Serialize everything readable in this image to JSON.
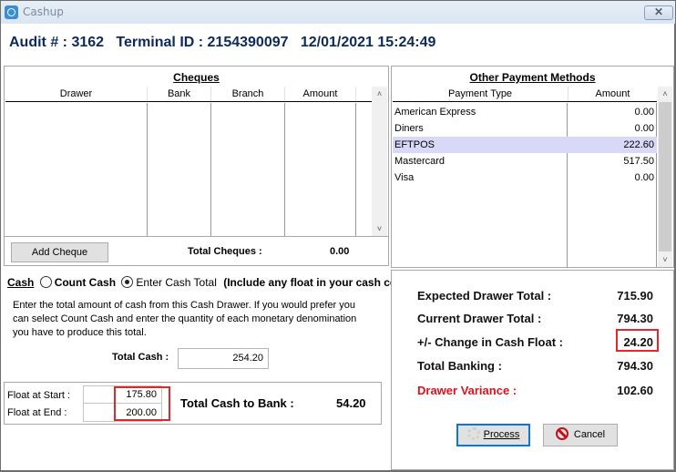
{
  "window": {
    "title": "Cashup",
    "close_label": "✕"
  },
  "header": {
    "text": "Audit # : 3162   Terminal ID : 2154390097   12/01/2021 15:24:49"
  },
  "cheques": {
    "title": "Cheques",
    "columns": [
      "Drawer",
      "Bank",
      "Branch",
      "Amount"
    ],
    "rows": [],
    "add_button": "Add Cheque",
    "total_label": "Total Cheques :",
    "total_value": "0.00"
  },
  "payments": {
    "title": "Other Payment Methods",
    "columns": [
      "Payment Type",
      "Amount"
    ],
    "rows": [
      {
        "type": "American Express",
        "amount": "0.00"
      },
      {
        "type": "Diners",
        "amount": "0.00"
      },
      {
        "type": "EFTPOS",
        "amount": "222.60"
      },
      {
        "type": "Mastercard",
        "amount": "517.50"
      },
      {
        "type": "Visa",
        "amount": "0.00"
      }
    ],
    "selected_row": "EFTPOS"
  },
  "cash": {
    "label": "Cash",
    "option_count": "Count Cash",
    "option_enter": "Enter Cash Total",
    "selected_option": "Enter Cash Total",
    "note": "(Include any float in your cash count)",
    "instructions": "Enter the total amount of cash from this Cash Drawer.  If you would prefer you can select Count Cash and enter the quantity of each monetary denomination you have to produce this total.",
    "total_label": "Total Cash :",
    "total_value": "254.20",
    "float_start_label": "Float at Start :",
    "float_start_value": "175.80",
    "float_end_label": "Float at End :",
    "float_end_value": "200.00",
    "to_bank_label": "Total Cash to Bank :",
    "to_bank_value": "54.20"
  },
  "summary": {
    "expected_label": "Expected Drawer Total :",
    "expected_value": "715.90",
    "current_label": "Current Drawer Total :",
    "current_value": "794.30",
    "change_label": "+/- Change in Cash Float :",
    "change_value": "24.20",
    "banking_label": "Total Banking :",
    "banking_value": "794.30",
    "variance_label": "Drawer Variance :",
    "variance_value": "102.60",
    "variance_color": "#e0101a"
  },
  "buttons": {
    "process": "Process",
    "cancel": "Cancel"
  }
}
